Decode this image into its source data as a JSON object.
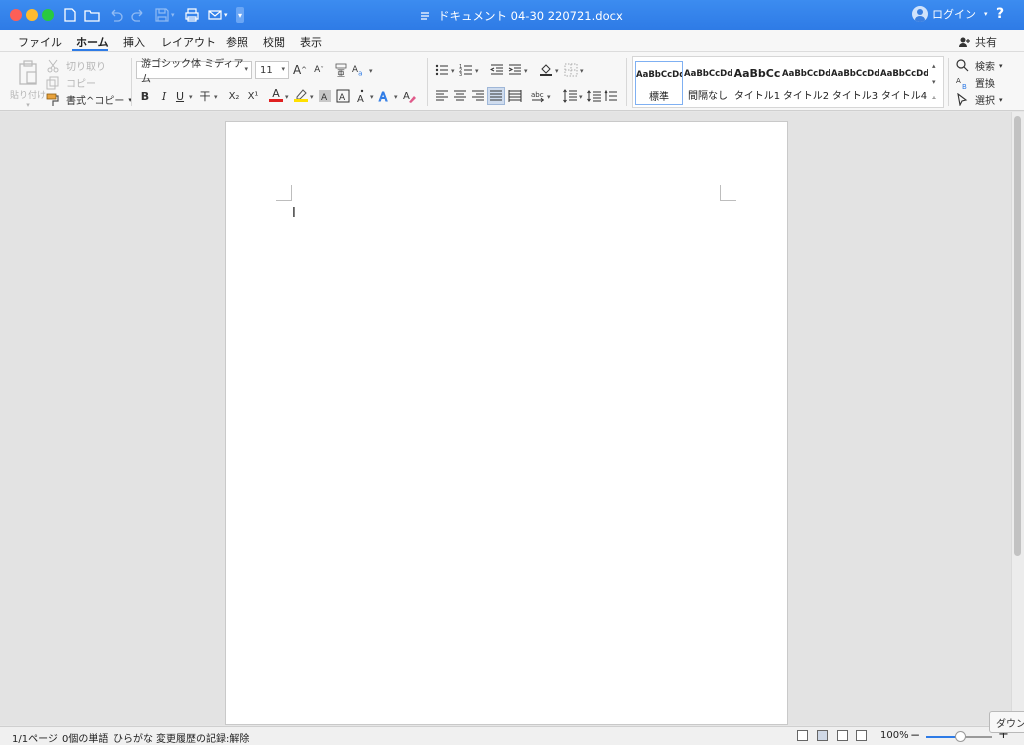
{
  "titlebar": {
    "doc_title": "ドキュメント 04-30 220721.docx",
    "login_label": "ログイン",
    "help_label": "?"
  },
  "tabs": [
    {
      "label": "ファイル"
    },
    {
      "label": "ホーム"
    },
    {
      "label": "挿入"
    },
    {
      "label": "レイアウト"
    },
    {
      "label": "参照"
    },
    {
      "label": "校閲"
    },
    {
      "label": "表示"
    }
  ],
  "active_tab": "ホーム",
  "share_label": "共有",
  "clipboard": {
    "paste": "貼り付け",
    "cut": "切り取り",
    "copy": "コピー",
    "format_painter": "書式^コピー"
  },
  "font": {
    "family": "游ゴシック体 ミディアム",
    "size": "11",
    "bold": "B",
    "italic": "I",
    "underline": "U",
    "strike": "干",
    "subscript": "X₂",
    "superscript": "X¹",
    "font_color": "A",
    "grow": "A",
    "shrink": "A",
    "ruby": "亜",
    "clear": "A",
    "text_effects": "A",
    "char_border": "A",
    "char_shading": "A",
    "emphasis": "A"
  },
  "styles": [
    {
      "sample": "AaBbCcDd",
      "name": "標準"
    },
    {
      "sample": "AaBbCcDd",
      "name": "間隔なし"
    },
    {
      "sample": "AaBbCc",
      "name": "タイトル1"
    },
    {
      "sample": "AaBbCcDd",
      "name": "タイトル2"
    },
    {
      "sample": "AaBbCcDd",
      "name": "タイトル3"
    },
    {
      "sample": "AaBbCcDd",
      "name": "タイトル4"
    }
  ],
  "editing": {
    "find": "検索",
    "replace": "置換",
    "select": "選択"
  },
  "document": {
    "cursor_glyph": "I"
  },
  "status": {
    "page": "1/1ページ",
    "words": "0個の単語",
    "input_mode": "ひらがな",
    "track_changes": "変更履歴の記録:解除",
    "zoom": "100%",
    "zoom_minus": "−",
    "zoom_plus": "+"
  },
  "tooltip": "ダウン",
  "colors": {
    "accent": "#2e7be6",
    "font_color_bar": "#e02020",
    "highlight_bar": "#ffe000"
  }
}
